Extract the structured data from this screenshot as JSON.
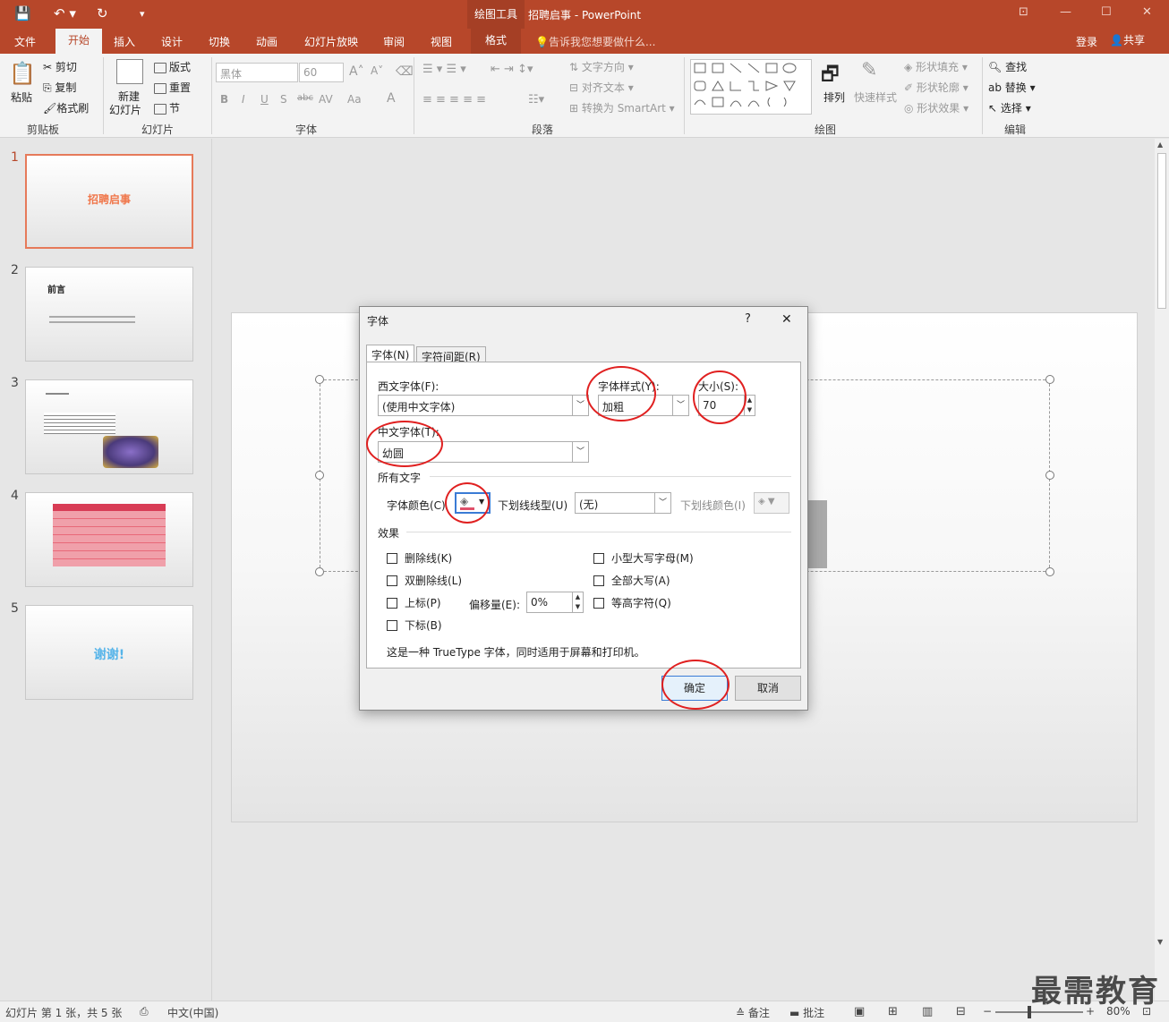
{
  "titlebar": {
    "context_label": "绘图工具",
    "document_title": "招聘启事 - PowerPoint",
    "qa_save": "💾",
    "qa_undo": "↶ ▾",
    "qa_redo": "↻",
    "qa_customize": "▾",
    "win_ribbon": "⊡",
    "win_min": "—",
    "win_max": "☐",
    "win_close": "✕"
  },
  "tabs": {
    "file": "文件",
    "home": "开始",
    "insert": "插入",
    "design": "设计",
    "transitions": "切换",
    "animations": "动画",
    "slideshow": "幻灯片放映",
    "review": "审阅",
    "view": "视图",
    "format": "格式",
    "tellme": "告诉我您想要做什么...",
    "login": "登录",
    "share": "共享"
  },
  "ribbon": {
    "clipboard": {
      "paste": "粘贴",
      "cut": "剪切",
      "copy": "复制",
      "format_painter": "格式刷",
      "label": "剪贴板"
    },
    "slides": {
      "new_slide": "新建",
      "new_slide2": "幻灯片",
      "layout": "版式",
      "reset": "重置",
      "section": "节",
      "label": "幻灯片"
    },
    "font": {
      "font_name": "黑体",
      "font_size": "60",
      "label": "字体",
      "bold": "B",
      "italic": "I",
      "underline": "U",
      "shadow": "S",
      "strike": "abc",
      "spacing": "AV",
      "case": "Aa",
      "grow": "A",
      "shrink": "A",
      "color": "A"
    },
    "paragraph": {
      "text_direction": "文字方向",
      "align_text": "对齐文本",
      "smartart": "转换为 SmartArt",
      "label": "段落"
    },
    "drawing": {
      "arrange": "排列",
      "quick_styles": "快速样式",
      "shape_fill": "形状填充",
      "shape_outline": "形状轮廓",
      "shape_effects": "形状效果",
      "label": "绘图"
    },
    "editing": {
      "find": "查找",
      "replace": "替换",
      "select": "选择",
      "label": "编辑"
    }
  },
  "thumbnails": [
    {
      "num": "1",
      "title": "招聘启事"
    },
    {
      "num": "2",
      "title": "前言"
    },
    {
      "num": "3",
      "title": ""
    },
    {
      "num": "4",
      "title": ""
    },
    {
      "num": "5",
      "title": "谢谢!"
    }
  ],
  "dialog": {
    "title": "字体",
    "help": "?",
    "close": "✕",
    "tab_font": "字体(N)",
    "tab_spacing": "字符间距(R)",
    "latin_font_label": "西文字体(F):",
    "latin_font_value": "(使用中文字体)",
    "style_label": "字体样式(Y):",
    "style_value": "加粗",
    "size_label": "大小(S):",
    "size_value": "70",
    "asian_font_label": "中文字体(T):",
    "asian_font_value": "幼圆",
    "all_text_label": "所有文字",
    "font_color_label": "字体颜色(C)",
    "underline_style_label": "下划线线型(U)",
    "underline_style_value": "(无)",
    "underline_color_label": "下划线颜色(I)",
    "effects_label": "效果",
    "strikethrough": "删除线(K)",
    "double_strike": "双删除线(L)",
    "superscript": "上标(P)",
    "subscript": "下标(B)",
    "offset_label": "偏移量(E):",
    "offset_value": "0%",
    "small_caps": "小型大写字母(M)",
    "all_caps": "全部大写(A)",
    "equalize": "等高字符(Q)",
    "info": "这是一种 TrueType 字体，同时适用于屏幕和打印机。",
    "ok": "确定",
    "cancel": "取消"
  },
  "statusbar": {
    "slide_info": "幻灯片 第 1 张，共 5 张",
    "language": "中文(中国)",
    "notes": "备注",
    "comments": "批注",
    "zoom": "80%"
  },
  "watermark": "最需教育",
  "colors": {
    "accent": "#b7472a",
    "accent_dark": "#a53f25",
    "annotation_red": "#e02020",
    "thumb1_title": "#f0764a",
    "thumb5_title": "#56b4e9"
  }
}
